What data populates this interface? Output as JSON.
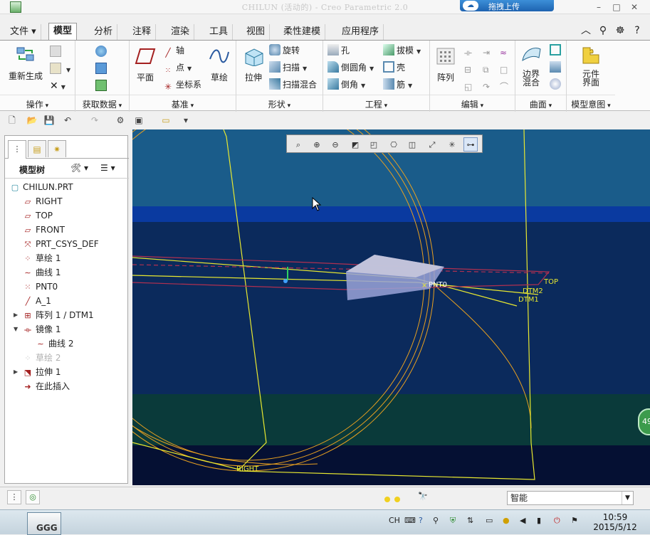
{
  "window": {
    "title": "CHILUN (活动的) - Creo Parametric 2.0",
    "upload_label": "拖拽上传",
    "controls": {
      "minimize": "–",
      "restore": "□",
      "close": "✕"
    }
  },
  "tabs": [
    {
      "label": "文件 ▾",
      "active": false
    },
    {
      "label": "模型",
      "active": true
    },
    {
      "label": "分析",
      "active": false
    },
    {
      "label": "注释",
      "active": false
    },
    {
      "label": "渲染",
      "active": false
    },
    {
      "label": "工具",
      "active": false
    },
    {
      "label": "视图",
      "active": false
    },
    {
      "label": "柔性建模",
      "active": false
    },
    {
      "label": "应用程序",
      "active": false
    }
  ],
  "ribbon": {
    "groups": {
      "operations": "操作",
      "get_data": "获取数据",
      "datum": "基准",
      "shapes": "形状",
      "engineering": "工程",
      "editing": "编辑",
      "surfaces": "曲面",
      "model_intent": "模型意图"
    },
    "buttons": {
      "regenerate": "重新生成",
      "axis": "轴",
      "point": "点",
      "plane": "平面",
      "csys": "坐标系",
      "sketch": "草绘",
      "extrude": "拉伸",
      "revolve": "旋转",
      "sweep": "扫描",
      "swept_blend": "扫描混合",
      "hole": "孔",
      "round": "倒圆角",
      "chamfer": "倒角",
      "draft": "拔模",
      "shell": "壳",
      "rib": "筋",
      "pattern": "阵列",
      "boundary_blend": "边界\n混合",
      "component_interface": "元件\n界面"
    }
  },
  "model_tree": {
    "header": "模型树",
    "nodes": [
      {
        "label": "CHILUN.PRT",
        "icon": "part-icon",
        "level": 0,
        "expandable": false,
        "dim": false
      },
      {
        "label": "RIGHT",
        "icon": "datum-plane-icon",
        "level": 1,
        "expandable": false,
        "dim": false
      },
      {
        "label": "TOP",
        "icon": "datum-plane-icon",
        "level": 1,
        "expandable": false,
        "dim": false
      },
      {
        "label": "FRONT",
        "icon": "datum-plane-icon",
        "level": 1,
        "expandable": false,
        "dim": false
      },
      {
        "label": "PRT_CSYS_DEF",
        "icon": "csys-icon",
        "level": 1,
        "expandable": false,
        "dim": false
      },
      {
        "label": "草绘 1",
        "icon": "sketch-icon",
        "level": 1,
        "expandable": false,
        "dim": false
      },
      {
        "label": "曲线 1",
        "icon": "curve-icon",
        "level": 1,
        "expandable": false,
        "dim": false
      },
      {
        "label": "PNT0",
        "icon": "datum-point-icon",
        "level": 1,
        "expandable": false,
        "dim": false
      },
      {
        "label": "A_1",
        "icon": "datum-axis-icon",
        "level": 1,
        "expandable": false,
        "dim": false
      },
      {
        "label": "阵列 1 / DTM1",
        "icon": "pattern-icon",
        "level": 1,
        "expandable": true,
        "expanded": false,
        "dim": false
      },
      {
        "label": "镜像 1",
        "icon": "mirror-icon",
        "level": 1,
        "expandable": true,
        "expanded": true,
        "dim": false
      },
      {
        "label": "曲线 2",
        "icon": "curve-icon",
        "level": 2,
        "expandable": false,
        "dim": false
      },
      {
        "label": "草绘 2",
        "icon": "sketch-icon",
        "level": 1,
        "expandable": false,
        "dim": true
      },
      {
        "label": "拉伸 1",
        "icon": "extrude-icon",
        "level": 1,
        "expandable": true,
        "expanded": false,
        "dim": false
      },
      {
        "label": "在此插入",
        "icon": "insert-here-icon",
        "level": 1,
        "expandable": false,
        "dim": false
      }
    ]
  },
  "viewport": {
    "labels": {
      "pnt0": "PNT0",
      "top": "TOP",
      "dtm2": "DTM2",
      "dtm1": "DTM1",
      "right": "RIGHT"
    },
    "badge": "49"
  },
  "statusbar": {
    "filter_value": "智能"
  },
  "taskbar": {
    "app_label": "GGG",
    "lang": "CH",
    "time": "10:59",
    "date": "2015/5/12"
  },
  "colors": {
    "viewport_top": "#1a5c8a",
    "viewport_band": "#0a3a9a",
    "viewport_mid": "#0b2a5c",
    "viewport_green": "#0a3a3a",
    "viewport_bottom": "#051033",
    "datum_yellow": "#e8e830",
    "curve_orange": "#e8a020",
    "plane_red": "#b03050"
  }
}
